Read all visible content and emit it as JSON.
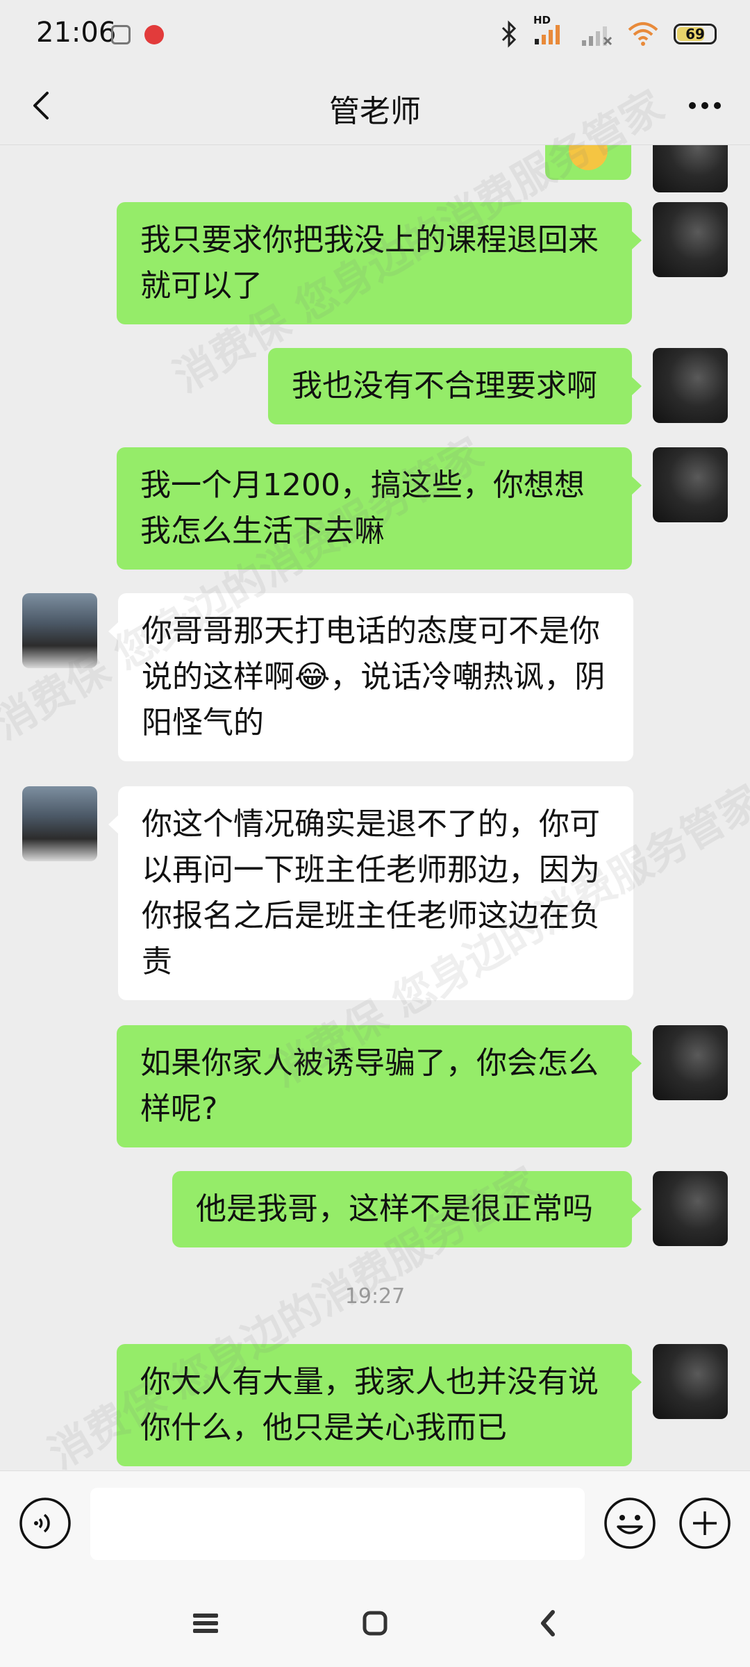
{
  "status_bar": {
    "time": "21:06",
    "network_badge": "HD",
    "battery_level": "69",
    "battery_fraction": 0.69
  },
  "header": {
    "title": "管老师"
  },
  "messages": [
    {
      "side": "sent",
      "text": ""
    },
    {
      "side": "sent",
      "text": "我只要求你把我没上的课程退回来就可以了"
    },
    {
      "side": "sent",
      "text": "我也没有不合理要求啊"
    },
    {
      "side": "sent",
      "text": "我一个月1200，搞这些，你想想我怎么生活下去嘛"
    },
    {
      "side": "received",
      "text": "你哥哥那天打电话的态度可不是你说的这样啊😂，说话冷嘲热讽，阴阳怪气的"
    },
    {
      "side": "received",
      "text": "你这个情况确实是退不了的，你可以再问一下班主任老师那边，因为你报名之后是班主任老师这边在负责"
    },
    {
      "side": "sent",
      "text": "如果你家人被诱导骗了，你会怎么样呢?"
    },
    {
      "side": "sent",
      "text": "他是我哥，这样不是很正常吗"
    },
    {
      "side": "sent",
      "text": "你大人有大量，我家人也并没有说你什么，他只是关心我而已"
    }
  ],
  "timestamp": "19:27",
  "watermark": "消费保 您身边的消费服务管家",
  "colors": {
    "sent_bubble": "#95ec69",
    "received_bubble": "#ffffff",
    "background": "#ededed"
  }
}
